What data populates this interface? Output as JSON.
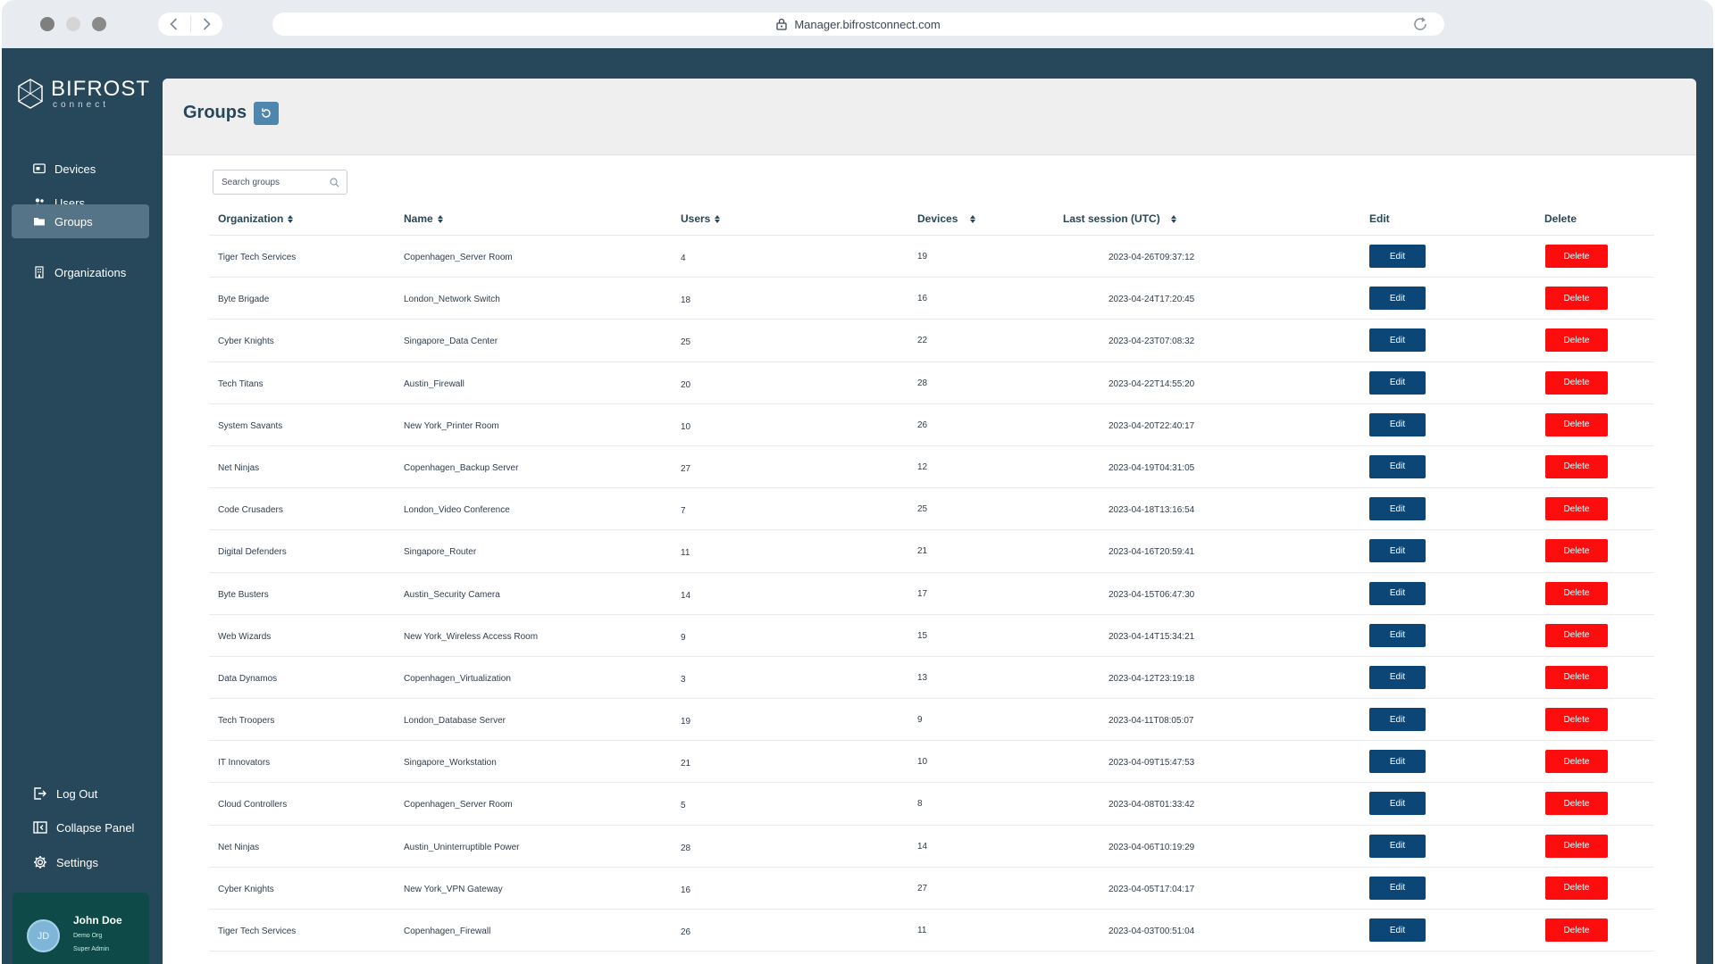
{
  "browser": {
    "url": "Manager.bifrostconnect.com",
    "traffic_colors": [
      "#7f7f7f",
      "#d5d5d5",
      "#8a8a8a"
    ]
  },
  "brand": {
    "name": "BIFROST",
    "sub": "connect"
  },
  "sidebar": {
    "items": [
      {
        "label": "Devices",
        "icon": "devices-icon"
      },
      {
        "label": "Users",
        "icon": "users-icon"
      },
      {
        "label": "Groups",
        "icon": "folder-icon",
        "active": true
      },
      {
        "label": "Organizations",
        "icon": "building-icon"
      }
    ],
    "bottom": [
      {
        "label": "Log Out",
        "icon": "logout-icon"
      },
      {
        "label": "Collapse Panel",
        "icon": "collapse-icon"
      },
      {
        "label": "Settings",
        "icon": "gear-icon"
      }
    ],
    "user": {
      "initials": "JD",
      "name": "John Doe",
      "org": "Demo Org",
      "role": "Super Admin"
    }
  },
  "page": {
    "title": "Groups",
    "search_placeholder": "Search groups"
  },
  "table": {
    "headers": [
      "Organization",
      "Name",
      "Users",
      "Devices",
      "Last session (UTC)",
      "Edit",
      "Delete"
    ],
    "edit_label": "Edit",
    "delete_label": "Delete",
    "rows": [
      [
        "Tiger Tech Services",
        "Copenhagen_Server Room",
        "4",
        "19",
        "2023-04-26T09:37:12"
      ],
      [
        "Byte Brigade",
        "London_Network Switch",
        "18",
        "16",
        "2023-04-24T17:20:45"
      ],
      [
        "Cyber Knights",
        "Singapore_Data Center",
        "25",
        "22",
        "2023-04-23T07:08:32"
      ],
      [
        "Tech Titans",
        "Austin_Firewall",
        "20",
        "28",
        "2023-04-22T14:55:20"
      ],
      [
        "System Savants",
        "New York_Printer Room",
        "10",
        "26",
        "2023-04-20T22:40:17"
      ],
      [
        "Net Ninjas",
        "Copenhagen_Backup Server",
        "27",
        "12",
        "2023-04-19T04:31:05"
      ],
      [
        "Code Crusaders",
        "London_Video Conference",
        "7",
        "25",
        "2023-04-18T13:16:54"
      ],
      [
        "Digital Defenders",
        "Singapore_Router",
        "11",
        "21",
        "2023-04-16T20:59:41"
      ],
      [
        "Byte Busters",
        "Austin_Security Camera",
        "14",
        "17",
        "2023-04-15T06:47:30"
      ],
      [
        "Web Wizards",
        "New York_Wireless Access Room",
        "9",
        "15",
        "2023-04-14T15:34:21"
      ],
      [
        "Data Dynamos",
        "Copenhagen_Virtualization",
        "3",
        "13",
        "2023-04-12T23:19:18"
      ],
      [
        "Tech Troopers",
        "London_Database Server",
        "19",
        "9",
        "2023-04-11T08:05:07"
      ],
      [
        "IT Innovators",
        "Singapore_Workstation",
        "21",
        "10",
        "2023-04-09T15:47:53"
      ],
      [
        "Cloud Controllers",
        "Copenhagen_Server Room",
        "5",
        "8",
        "2023-04-08T01:33:42"
      ],
      [
        "Net Ninjas",
        "Austin_Uninterruptible Power",
        "28",
        "14",
        "2023-04-06T10:19:29"
      ],
      [
        "Cyber Knights",
        "New York_VPN Gateway",
        "16",
        "27",
        "2023-04-05T17:04:17"
      ],
      [
        "Tiger Tech Services",
        "Copenhagen_Firewall",
        "26",
        "11",
        "2023-04-03T00:51:04"
      ]
    ]
  },
  "colors": {
    "frame": "#27475a",
    "active_nav": "#567488",
    "edit_button": "#0b4677",
    "delete_button": "#fd0d0d",
    "user_card": "#0e4a47"
  }
}
